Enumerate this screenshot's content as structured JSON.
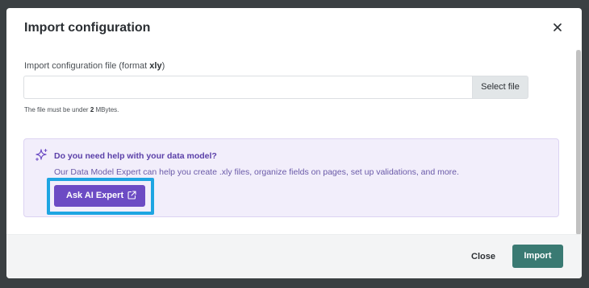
{
  "dialog": {
    "title": "Import configuration",
    "close_icon": "close-icon"
  },
  "file_field": {
    "label_prefix": "Import configuration file (format ",
    "label_format": "xly",
    "label_suffix": ")",
    "value": "",
    "placeholder": "",
    "select_button_label": "Select file",
    "hint_prefix": "The file must be under ",
    "hint_size": "2",
    "hint_suffix": " MBytes."
  },
  "help": {
    "icon": "sparkle-icon",
    "title": "Do you need help with your data model?",
    "text": "Our Data Model Expert can help you create .xly files, organize fields on pages, set up validations, and more.",
    "button_label": "Ask AI Expert",
    "button_icon": "external-link-icon"
  },
  "footer": {
    "close_label": "Close",
    "import_label": "Import"
  },
  "colors": {
    "accent_purple": "#6c4bc4",
    "import_teal": "#3a7a73",
    "highlight_blue": "#1ea5e2",
    "help_bg": "#f2eefb"
  }
}
